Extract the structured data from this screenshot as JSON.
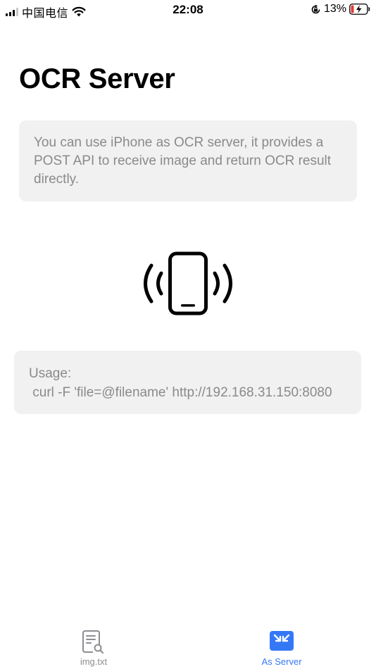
{
  "status_bar": {
    "carrier": "中国电信",
    "time": "22:08",
    "battery_percent": "13%",
    "icons": [
      "signal-icon",
      "wifi-icon",
      "rotation-lock-icon",
      "battery-charging-icon"
    ]
  },
  "page": {
    "title": "OCR Server",
    "description": "You can use iPhone as OCR server, it provides a POST API to receive image and return OCR result directly.",
    "hero_icon": "phone-vibrate-icon",
    "usage_label": "Usage:",
    "usage_command": " curl -F 'file=@filename' http://192.168.31.150:8080"
  },
  "tab_bar": {
    "tabs": [
      {
        "label": "img.txt",
        "icon": "document-search-icon",
        "selected": false
      },
      {
        "label": "As Server",
        "icon": "arrows-inward-icon",
        "selected": true
      }
    ]
  },
  "colors": {
    "accent": "#3478f6",
    "box_background": "#f1f1f1",
    "secondary_text": "#8a8a8a",
    "inactive_tab": "#8e8e93"
  }
}
